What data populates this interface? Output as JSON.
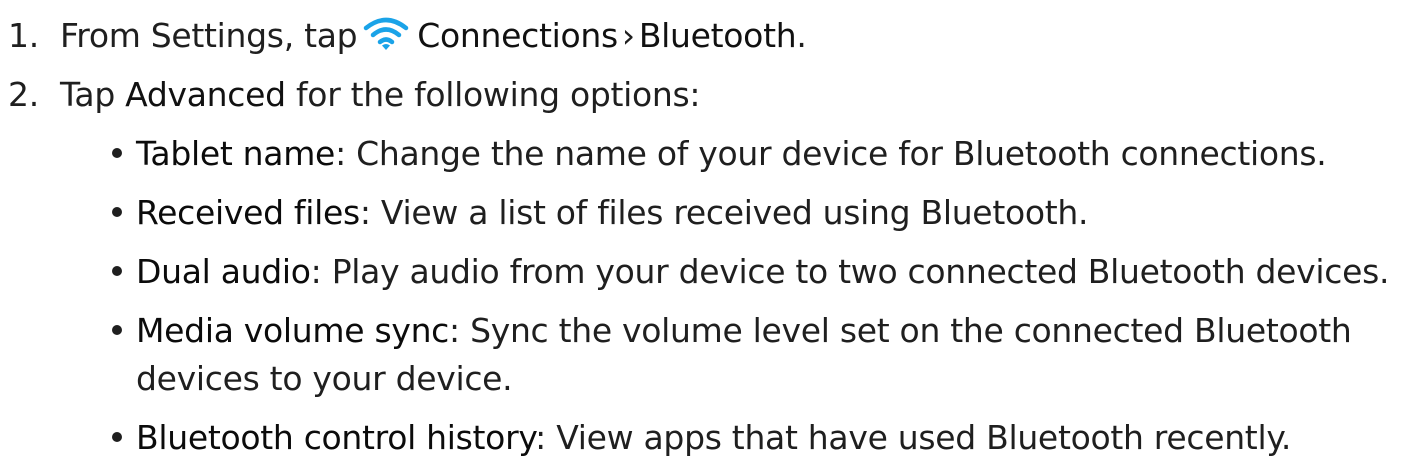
{
  "steps": [
    {
      "number": "1.",
      "text_before": "From Settings, tap",
      "ui_label_1": "Connections",
      "separator": "›",
      "ui_label_2": "Bluetooth",
      "text_after": ".",
      "icon": "wifi-icon",
      "icon_color": "#1aa3e8"
    },
    {
      "number": "2.",
      "text_before": "Tap",
      "ui_label": "Advanced",
      "text_after": "for the following options:"
    }
  ],
  "options": [
    {
      "term": "Tablet name",
      "colon": ":",
      "description": "Change the name of your device for Bluetooth connections."
    },
    {
      "term": "Received files",
      "colon": ":",
      "description": "View a list of files received using Bluetooth."
    },
    {
      "term": "Dual audio",
      "colon": ":",
      "description": "Play audio from your device to two connected Bluetooth devices."
    },
    {
      "term": "Media volume sync",
      "colon": ":",
      "description": "Sync the volume level set on the connected Bluetooth",
      "description_cont": "devices to your device."
    },
    {
      "term": "Bluetooth control history",
      "colon": ":",
      "description": "View apps that have used Bluetooth recently."
    }
  ]
}
